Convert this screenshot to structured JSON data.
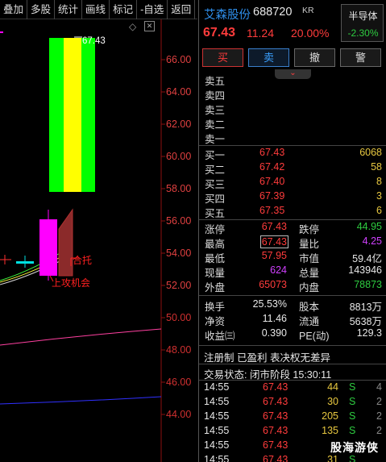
{
  "toolbar": {
    "items": [
      "叠加",
      "多股",
      "统计",
      "画线",
      "标记",
      "-自选",
      "返回"
    ]
  },
  "chart": {
    "price_axis": [
      "66.00",
      "64.00",
      "62.00",
      "60.00",
      "58.00",
      "56.00",
      "54.00",
      "52.00",
      "50.00",
      "48.00",
      "46.00",
      "44.00"
    ],
    "peak_label": "67.43",
    "notes": {
      "top_left": "合托",
      "bottom": "上攻机会"
    },
    "colors": {
      "up": "#ff00ff",
      "limit_green": "#00ff00",
      "limit_yellow": "#ffff00"
    }
  },
  "stock": {
    "name": "艾森股份",
    "code": "688720",
    "flag": "KR",
    "price": "67.43",
    "change": "11.24",
    "change_pct": "20.00%",
    "sector": {
      "name": "半导体",
      "pct": "-2.30%"
    }
  },
  "trade_buttons": {
    "buy": "买",
    "sell": "卖",
    "cancel": "撤",
    "alert": "警"
  },
  "order_book": {
    "asks": [
      {
        "label": "卖五",
        "price": "",
        "vol": ""
      },
      {
        "label": "卖四",
        "price": "",
        "vol": ""
      },
      {
        "label": "卖三",
        "price": "",
        "vol": ""
      },
      {
        "label": "卖二",
        "price": "",
        "vol": ""
      },
      {
        "label": "卖一",
        "price": "",
        "vol": ""
      }
    ],
    "bids": [
      {
        "label": "买一",
        "price": "67.43",
        "vol": "6068"
      },
      {
        "label": "买二",
        "price": "67.42",
        "vol": "58"
      },
      {
        "label": "买三",
        "price": "67.40",
        "vol": "8"
      },
      {
        "label": "买四",
        "price": "67.39",
        "vol": "3"
      },
      {
        "label": "买五",
        "price": "67.35",
        "vol": "6"
      }
    ]
  },
  "stats": {
    "limit_up": {
      "label": "涨停",
      "value": "67.43"
    },
    "limit_down": {
      "label": "跌停",
      "value": "44.95"
    },
    "high": {
      "label": "最高",
      "value": "67.43"
    },
    "vol_ratio": {
      "label": "量比",
      "value": "4.25"
    },
    "low": {
      "label": "最低",
      "value": "57.95"
    },
    "mkt_cap": {
      "label": "市值",
      "value": "59.4亿"
    },
    "cur_vol": {
      "label": "现量",
      "value": "624"
    },
    "total_vol": {
      "label": "总量",
      "value": "143946"
    },
    "outer": {
      "label": "外盘",
      "value": "65073"
    },
    "inner": {
      "label": "内盘",
      "value": "78873"
    },
    "turnover": {
      "label": "换手",
      "value": "25.53%"
    },
    "equity": {
      "label": "股本",
      "value": "8813万"
    },
    "net_asset": {
      "label": "净资",
      "value": "11.46"
    },
    "float": {
      "label": "流通",
      "value": "5638万"
    },
    "eps": {
      "label": "收益㈢",
      "value": "0.390"
    },
    "pe": {
      "label": "PE(动)",
      "value": "129.3"
    }
  },
  "tags": "注册制 已盈利 表决权无差异",
  "trade_status": "交易状态: 闭市阶段 15:30:11",
  "ticks": [
    {
      "time": "14:55",
      "price": "67.43",
      "vol": "44",
      "side": "S",
      "count": "4"
    },
    {
      "time": "14:55",
      "price": "67.43",
      "vol": "30",
      "side": "S",
      "count": "2"
    },
    {
      "time": "14:55",
      "price": "67.43",
      "vol": "205",
      "side": "S",
      "count": "2"
    },
    {
      "time": "14:55",
      "price": "67.43",
      "vol": "135",
      "side": "S",
      "count": "2"
    },
    {
      "time": "14:55",
      "price": "67.43",
      "vol": "",
      "side": "",
      "count": ""
    },
    {
      "time": "14:55",
      "price": "67.43",
      "vol": "31",
      "side": "S",
      "count": ""
    }
  ],
  "watermark": "股海游侠"
}
